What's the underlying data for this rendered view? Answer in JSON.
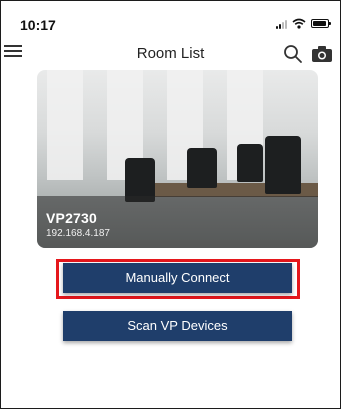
{
  "status_bar": {
    "time": "10:17"
  },
  "header": {
    "title": "Room List",
    "icons": [
      "menu-icon",
      "search-icon",
      "camera-icon"
    ]
  },
  "room": {
    "name": "VP2730",
    "ip": "192.168.4.187"
  },
  "actions": {
    "manual_connect_label": "Manually Connect",
    "scan_label": "Scan VP Devices"
  },
  "colors": {
    "button_bg": "#1f3e6b",
    "highlight": "#e5171c"
  }
}
